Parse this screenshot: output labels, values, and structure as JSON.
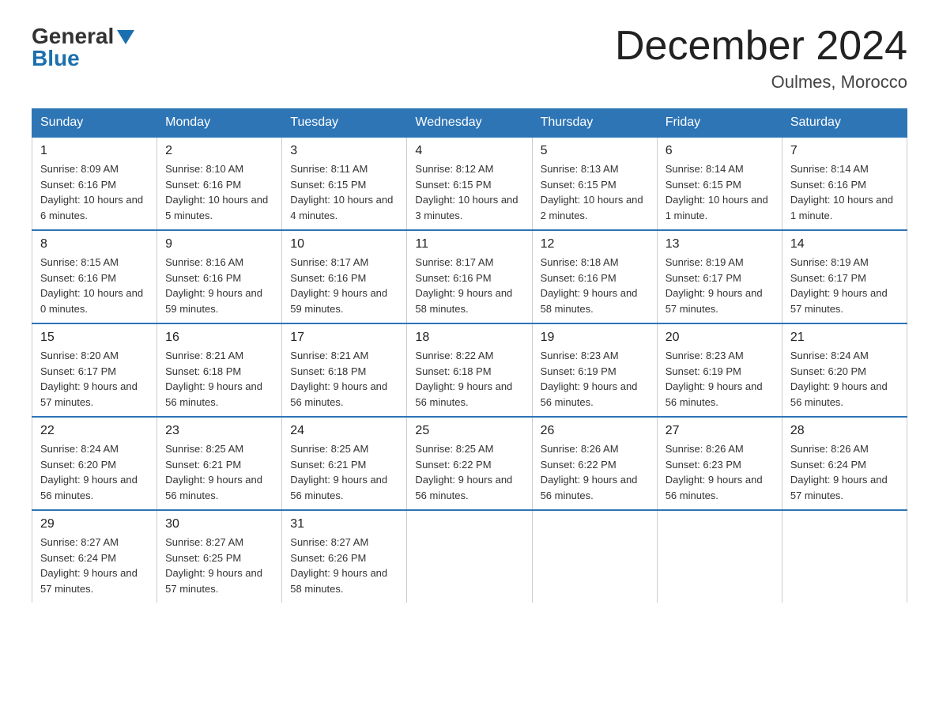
{
  "header": {
    "logo_general": "General",
    "logo_blue": "Blue",
    "month_title": "December 2024",
    "location": "Oulmes, Morocco"
  },
  "days_of_week": [
    "Sunday",
    "Monday",
    "Tuesday",
    "Wednesday",
    "Thursday",
    "Friday",
    "Saturday"
  ],
  "weeks": [
    [
      {
        "day": "1",
        "sunrise": "8:09 AM",
        "sunset": "6:16 PM",
        "daylight": "10 hours and 6 minutes."
      },
      {
        "day": "2",
        "sunrise": "8:10 AM",
        "sunset": "6:16 PM",
        "daylight": "10 hours and 5 minutes."
      },
      {
        "day": "3",
        "sunrise": "8:11 AM",
        "sunset": "6:15 PM",
        "daylight": "10 hours and 4 minutes."
      },
      {
        "day": "4",
        "sunrise": "8:12 AM",
        "sunset": "6:15 PM",
        "daylight": "10 hours and 3 minutes."
      },
      {
        "day": "5",
        "sunrise": "8:13 AM",
        "sunset": "6:15 PM",
        "daylight": "10 hours and 2 minutes."
      },
      {
        "day": "6",
        "sunrise": "8:14 AM",
        "sunset": "6:15 PM",
        "daylight": "10 hours and 1 minute."
      },
      {
        "day": "7",
        "sunrise": "8:14 AM",
        "sunset": "6:16 PM",
        "daylight": "10 hours and 1 minute."
      }
    ],
    [
      {
        "day": "8",
        "sunrise": "8:15 AM",
        "sunset": "6:16 PM",
        "daylight": "10 hours and 0 minutes."
      },
      {
        "day": "9",
        "sunrise": "8:16 AM",
        "sunset": "6:16 PM",
        "daylight": "9 hours and 59 minutes."
      },
      {
        "day": "10",
        "sunrise": "8:17 AM",
        "sunset": "6:16 PM",
        "daylight": "9 hours and 59 minutes."
      },
      {
        "day": "11",
        "sunrise": "8:17 AM",
        "sunset": "6:16 PM",
        "daylight": "9 hours and 58 minutes."
      },
      {
        "day": "12",
        "sunrise": "8:18 AM",
        "sunset": "6:16 PM",
        "daylight": "9 hours and 58 minutes."
      },
      {
        "day": "13",
        "sunrise": "8:19 AM",
        "sunset": "6:17 PM",
        "daylight": "9 hours and 57 minutes."
      },
      {
        "day": "14",
        "sunrise": "8:19 AM",
        "sunset": "6:17 PM",
        "daylight": "9 hours and 57 minutes."
      }
    ],
    [
      {
        "day": "15",
        "sunrise": "8:20 AM",
        "sunset": "6:17 PM",
        "daylight": "9 hours and 57 minutes."
      },
      {
        "day": "16",
        "sunrise": "8:21 AM",
        "sunset": "6:18 PM",
        "daylight": "9 hours and 56 minutes."
      },
      {
        "day": "17",
        "sunrise": "8:21 AM",
        "sunset": "6:18 PM",
        "daylight": "9 hours and 56 minutes."
      },
      {
        "day": "18",
        "sunrise": "8:22 AM",
        "sunset": "6:18 PM",
        "daylight": "9 hours and 56 minutes."
      },
      {
        "day": "19",
        "sunrise": "8:23 AM",
        "sunset": "6:19 PM",
        "daylight": "9 hours and 56 minutes."
      },
      {
        "day": "20",
        "sunrise": "8:23 AM",
        "sunset": "6:19 PM",
        "daylight": "9 hours and 56 minutes."
      },
      {
        "day": "21",
        "sunrise": "8:24 AM",
        "sunset": "6:20 PM",
        "daylight": "9 hours and 56 minutes."
      }
    ],
    [
      {
        "day": "22",
        "sunrise": "8:24 AM",
        "sunset": "6:20 PM",
        "daylight": "9 hours and 56 minutes."
      },
      {
        "day": "23",
        "sunrise": "8:25 AM",
        "sunset": "6:21 PM",
        "daylight": "9 hours and 56 minutes."
      },
      {
        "day": "24",
        "sunrise": "8:25 AM",
        "sunset": "6:21 PM",
        "daylight": "9 hours and 56 minutes."
      },
      {
        "day": "25",
        "sunrise": "8:25 AM",
        "sunset": "6:22 PM",
        "daylight": "9 hours and 56 minutes."
      },
      {
        "day": "26",
        "sunrise": "8:26 AM",
        "sunset": "6:22 PM",
        "daylight": "9 hours and 56 minutes."
      },
      {
        "day": "27",
        "sunrise": "8:26 AM",
        "sunset": "6:23 PM",
        "daylight": "9 hours and 56 minutes."
      },
      {
        "day": "28",
        "sunrise": "8:26 AM",
        "sunset": "6:24 PM",
        "daylight": "9 hours and 57 minutes."
      }
    ],
    [
      {
        "day": "29",
        "sunrise": "8:27 AM",
        "sunset": "6:24 PM",
        "daylight": "9 hours and 57 minutes."
      },
      {
        "day": "30",
        "sunrise": "8:27 AM",
        "sunset": "6:25 PM",
        "daylight": "9 hours and 57 minutes."
      },
      {
        "day": "31",
        "sunrise": "8:27 AM",
        "sunset": "6:26 PM",
        "daylight": "9 hours and 58 minutes."
      },
      null,
      null,
      null,
      null
    ]
  ]
}
